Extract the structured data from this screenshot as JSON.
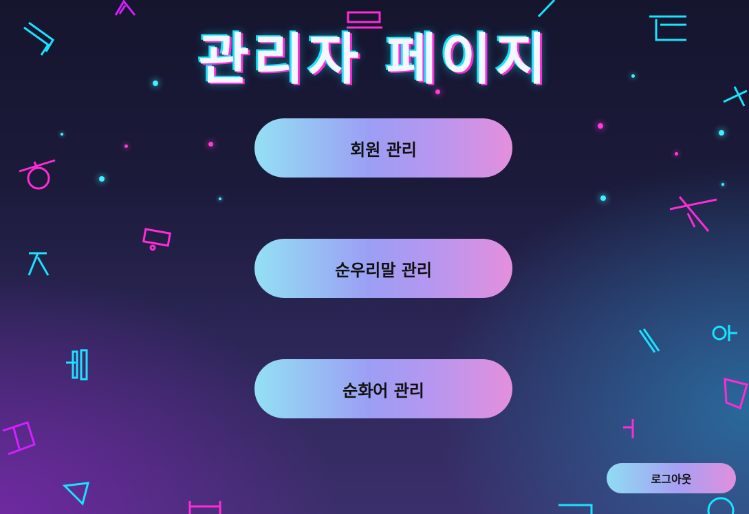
{
  "page": {
    "title": "관리자 페이지"
  },
  "menu": {
    "member_management": "회원 관리",
    "pure_korean_word_management": "순우리말 관리",
    "pure_phrase_management": "순화어 관리"
  },
  "logout": {
    "label": "로그아웃"
  },
  "colors": {
    "neon_cyan": "#19e3ff",
    "neon_magenta": "#ff2bd6",
    "button_gradient_start": "#93e0f4",
    "button_gradient_end": "#e48fdd"
  },
  "decorations": {
    "icon": "neon-hangul-glyph-icon"
  }
}
